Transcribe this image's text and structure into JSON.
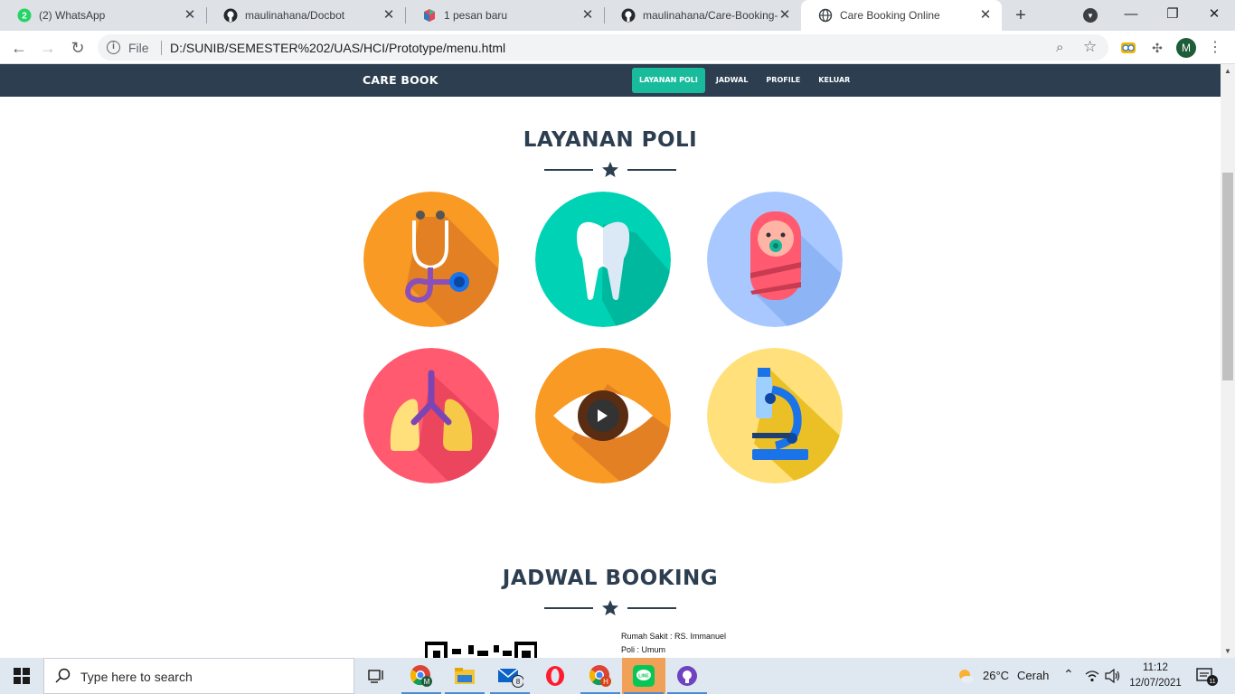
{
  "browser": {
    "tabs": [
      {
        "title": "(2) WhatsApp",
        "badge": "2",
        "icon": "whatsapp-icon",
        "active": false
      },
      {
        "title": "maulinahana/Docbot",
        "icon": "github-icon",
        "active": false
      },
      {
        "title": "1 pesan baru",
        "icon": "pesan-app-icon",
        "active": false
      },
      {
        "title": "maulinahana/Care-Booking-O",
        "icon": "github-icon",
        "active": false
      },
      {
        "title": "Care Booking Online",
        "icon": "globe-icon",
        "active": true
      }
    ],
    "address": {
      "scheme_label": "File",
      "url": "D:/SUNIB/SEMESTER%202/UAS/HCI/Prototype/menu.html"
    },
    "profile_initial": "M"
  },
  "site": {
    "brand": "CARE BOOK",
    "nav": [
      {
        "label": "LAYANAN POLI",
        "active": true
      },
      {
        "label": "JADWAL",
        "active": false
      },
      {
        "label": "PROFILE",
        "active": false
      },
      {
        "label": "KELUAR",
        "active": false
      }
    ],
    "colors": {
      "navbar": "#2c3e50",
      "accent": "#18bc9c",
      "heading": "#2c3e50"
    },
    "layanan": {
      "title": "LAYANAN POLI",
      "items": [
        {
          "icon": "stethoscope-icon",
          "color": "#f89a23"
        },
        {
          "icon": "tooth-icon",
          "color": "#00d3b5"
        },
        {
          "icon": "baby-icon",
          "color": "#a8c8ff"
        },
        {
          "icon": "lungs-icon",
          "color": "#ff5a6f"
        },
        {
          "icon": "eye-icon",
          "color": "#f89a23"
        },
        {
          "icon": "microscope-icon",
          "color": "#ffe07a"
        }
      ]
    },
    "jadwal": {
      "title": "JADWAL BOOKING",
      "rumah_sakit": "Rumah Sakit : RS. Immanuel",
      "poli": "Poli : Umum"
    }
  },
  "taskbar": {
    "search_placeholder": "Type here to search",
    "mail_badge": "8",
    "weather": {
      "temp": "26°C",
      "condition": "Cerah"
    },
    "time": "11:12",
    "date": "12/07/2021",
    "notification_count": "11"
  }
}
